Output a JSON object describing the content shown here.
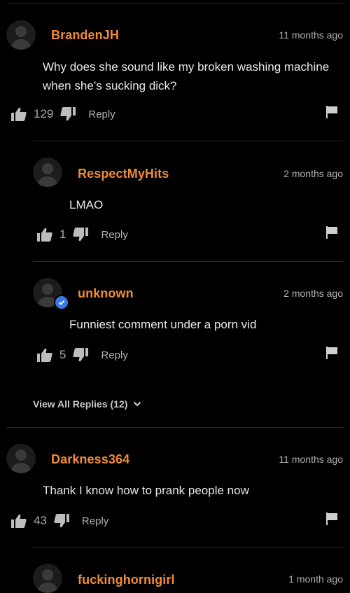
{
  "comments": [
    {
      "username": "BrandenJH",
      "time": "11 months ago",
      "text_line1": "Why does she sound like my broken washing machine",
      "text_line2": "when she’s sucking dick?",
      "likes": "129",
      "reply_label": "Reply"
    },
    {
      "username": "RespectMyHits",
      "time": "2 months ago",
      "text_line1": "LMAO",
      "likes": "1",
      "reply_label": "Reply"
    },
    {
      "username": "unknown",
      "time": "2 months ago",
      "text_line1": "Funniest comment under a porn vid",
      "likes": "5",
      "reply_label": "Reply"
    },
    {
      "username": "Darkness364",
      "time": "11 months ago",
      "text_line1": "Thank I know how to prank people now",
      "likes": "43",
      "reply_label": "Reply"
    },
    {
      "username": "fuckinghornigirl",
      "time": "1 month ago"
    }
  ],
  "view_all_replies": "View All Replies (12)",
  "colors": {
    "username": "#f08b36",
    "background": "#000000",
    "verified": "#3b79e8"
  },
  "icons": [
    "avatar-placeholder-icon",
    "thumbs-up-icon",
    "thumbs-down-icon",
    "flag-icon",
    "verified-check-icon",
    "chevron-down-icon"
  ]
}
